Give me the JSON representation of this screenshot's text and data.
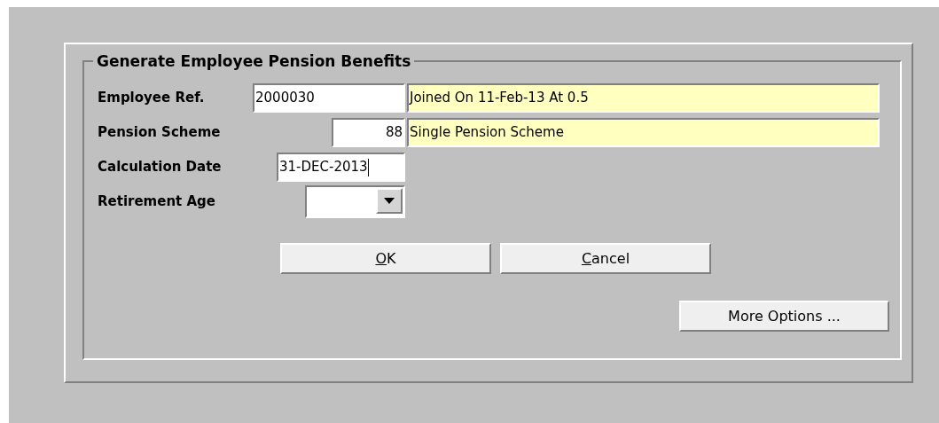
{
  "group_title": "Generate Employee Pension Benefits",
  "fields": [
    {
      "kind": "text",
      "label": "Employee Ref.",
      "value": "2000030",
      "focused": false,
      "description": "Joined On 11-Feb-13 At 0.5"
    },
    {
      "kind": "number",
      "label": "Pension Scheme",
      "value": "88",
      "focused": false,
      "description": "Single Pension Scheme"
    },
    {
      "kind": "text",
      "label": "Calculation Date",
      "value": "31-DEC-2013",
      "focused": true
    },
    {
      "kind": "dropdown",
      "label": "Retirement Age"
    }
  ],
  "buttons": [
    {
      "label": "OK",
      "underline_first": true
    },
    {
      "label": "Cancel",
      "underline_first": true
    }
  ],
  "more_button": {
    "label": "More Options ...",
    "underline_first": false
  }
}
